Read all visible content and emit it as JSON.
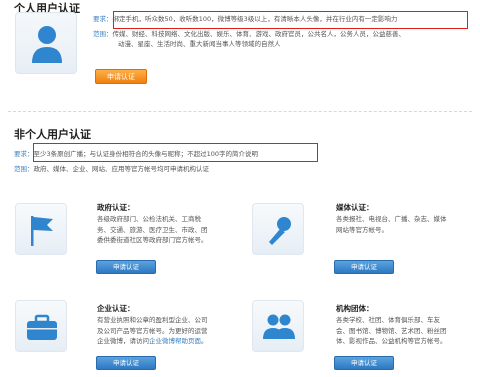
{
  "personal": {
    "title": "个人用户认证",
    "req_key": "要求：",
    "req_text": "绑定手机，听众数50，收听数100，微博等级3级以上，有清晰本人头像，并在行业内有一定影响力",
    "scope_key": "范围：",
    "scope_line1": "传媒、财经、科技网络、文化出版、娱乐、体育、游戏、政府官员，公共名人，公务人员，公益慈善、",
    "scope_line2": "动漫、星座、生活时尚、重大新闻当事人等领域的自然人",
    "button": "申请认证"
  },
  "org": {
    "title": "非个人用户认证",
    "req_key": "要求：",
    "req_text": "至少3条原创广播；与认证身份相符合的头像与昵称；不超过100字的简介说明",
    "scope_key": "范围：",
    "scope_text": "政府、媒体、企业、网站、应用等官方帐号均可申请机构认证"
  },
  "cards": [
    {
      "icon": "flag-icon",
      "title": "政府认证：",
      "desc": [
        "各级政府部门、公检法机关、工商税",
        "务、交通、旅游、医疗卫生、市政、团",
        "委供委街道社区等政府部门官方帐号。"
      ],
      "button": "申请认证"
    },
    {
      "icon": "microphone-icon",
      "title": "媒体认证：",
      "desc": [
        "各类报社、电视台、广播、杂志、媒体",
        "网站等官方帐号。"
      ],
      "button": "申请认证"
    },
    {
      "icon": "briefcase-icon",
      "title": "企业认证：",
      "desc_lines": [
        "有营业执照和公章的盈利型企业、公司",
        "及公司产品等官方帐号。为更好的运营",
        "企业微博，请访问"
      ],
      "desc_link": "企业微博帮助页面",
      "desc_tail": "。",
      "button": "申请认证"
    },
    {
      "icon": "people-icon",
      "title": "机构团体：",
      "desc": [
        "各类学校、社团、体育俱乐部、车友",
        "会、图书馆、博物馆、艺术团、粉丝团",
        "体、影视作品、公益机构等官方帐号。"
      ],
      "button": "申请认证"
    }
  ]
}
